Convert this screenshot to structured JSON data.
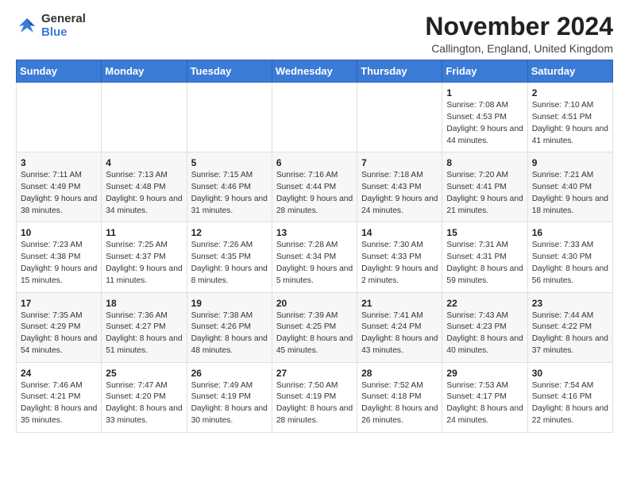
{
  "header": {
    "logo_general": "General",
    "logo_blue": "Blue",
    "month_title": "November 2024",
    "location": "Callington, England, United Kingdom"
  },
  "weekdays": [
    "Sunday",
    "Monday",
    "Tuesday",
    "Wednesday",
    "Thursday",
    "Friday",
    "Saturday"
  ],
  "weeks": [
    [
      {
        "day": "",
        "info": ""
      },
      {
        "day": "",
        "info": ""
      },
      {
        "day": "",
        "info": ""
      },
      {
        "day": "",
        "info": ""
      },
      {
        "day": "",
        "info": ""
      },
      {
        "day": "1",
        "info": "Sunrise: 7:08 AM\nSunset: 4:53 PM\nDaylight: 9 hours and 44 minutes."
      },
      {
        "day": "2",
        "info": "Sunrise: 7:10 AM\nSunset: 4:51 PM\nDaylight: 9 hours and 41 minutes."
      }
    ],
    [
      {
        "day": "3",
        "info": "Sunrise: 7:11 AM\nSunset: 4:49 PM\nDaylight: 9 hours and 38 minutes."
      },
      {
        "day": "4",
        "info": "Sunrise: 7:13 AM\nSunset: 4:48 PM\nDaylight: 9 hours and 34 minutes."
      },
      {
        "day": "5",
        "info": "Sunrise: 7:15 AM\nSunset: 4:46 PM\nDaylight: 9 hours and 31 minutes."
      },
      {
        "day": "6",
        "info": "Sunrise: 7:16 AM\nSunset: 4:44 PM\nDaylight: 9 hours and 28 minutes."
      },
      {
        "day": "7",
        "info": "Sunrise: 7:18 AM\nSunset: 4:43 PM\nDaylight: 9 hours and 24 minutes."
      },
      {
        "day": "8",
        "info": "Sunrise: 7:20 AM\nSunset: 4:41 PM\nDaylight: 9 hours and 21 minutes."
      },
      {
        "day": "9",
        "info": "Sunrise: 7:21 AM\nSunset: 4:40 PM\nDaylight: 9 hours and 18 minutes."
      }
    ],
    [
      {
        "day": "10",
        "info": "Sunrise: 7:23 AM\nSunset: 4:38 PM\nDaylight: 9 hours and 15 minutes."
      },
      {
        "day": "11",
        "info": "Sunrise: 7:25 AM\nSunset: 4:37 PM\nDaylight: 9 hours and 11 minutes."
      },
      {
        "day": "12",
        "info": "Sunrise: 7:26 AM\nSunset: 4:35 PM\nDaylight: 9 hours and 8 minutes."
      },
      {
        "day": "13",
        "info": "Sunrise: 7:28 AM\nSunset: 4:34 PM\nDaylight: 9 hours and 5 minutes."
      },
      {
        "day": "14",
        "info": "Sunrise: 7:30 AM\nSunset: 4:33 PM\nDaylight: 9 hours and 2 minutes."
      },
      {
        "day": "15",
        "info": "Sunrise: 7:31 AM\nSunset: 4:31 PM\nDaylight: 8 hours and 59 minutes."
      },
      {
        "day": "16",
        "info": "Sunrise: 7:33 AM\nSunset: 4:30 PM\nDaylight: 8 hours and 56 minutes."
      }
    ],
    [
      {
        "day": "17",
        "info": "Sunrise: 7:35 AM\nSunset: 4:29 PM\nDaylight: 8 hours and 54 minutes."
      },
      {
        "day": "18",
        "info": "Sunrise: 7:36 AM\nSunset: 4:27 PM\nDaylight: 8 hours and 51 minutes."
      },
      {
        "day": "19",
        "info": "Sunrise: 7:38 AM\nSunset: 4:26 PM\nDaylight: 8 hours and 48 minutes."
      },
      {
        "day": "20",
        "info": "Sunrise: 7:39 AM\nSunset: 4:25 PM\nDaylight: 8 hours and 45 minutes."
      },
      {
        "day": "21",
        "info": "Sunrise: 7:41 AM\nSunset: 4:24 PM\nDaylight: 8 hours and 43 minutes."
      },
      {
        "day": "22",
        "info": "Sunrise: 7:43 AM\nSunset: 4:23 PM\nDaylight: 8 hours and 40 minutes."
      },
      {
        "day": "23",
        "info": "Sunrise: 7:44 AM\nSunset: 4:22 PM\nDaylight: 8 hours and 37 minutes."
      }
    ],
    [
      {
        "day": "24",
        "info": "Sunrise: 7:46 AM\nSunset: 4:21 PM\nDaylight: 8 hours and 35 minutes."
      },
      {
        "day": "25",
        "info": "Sunrise: 7:47 AM\nSunset: 4:20 PM\nDaylight: 8 hours and 33 minutes."
      },
      {
        "day": "26",
        "info": "Sunrise: 7:49 AM\nSunset: 4:19 PM\nDaylight: 8 hours and 30 minutes."
      },
      {
        "day": "27",
        "info": "Sunrise: 7:50 AM\nSunset: 4:19 PM\nDaylight: 8 hours and 28 minutes."
      },
      {
        "day": "28",
        "info": "Sunrise: 7:52 AM\nSunset: 4:18 PM\nDaylight: 8 hours and 26 minutes."
      },
      {
        "day": "29",
        "info": "Sunrise: 7:53 AM\nSunset: 4:17 PM\nDaylight: 8 hours and 24 minutes."
      },
      {
        "day": "30",
        "info": "Sunrise: 7:54 AM\nSunset: 4:16 PM\nDaylight: 8 hours and 22 minutes."
      }
    ]
  ]
}
